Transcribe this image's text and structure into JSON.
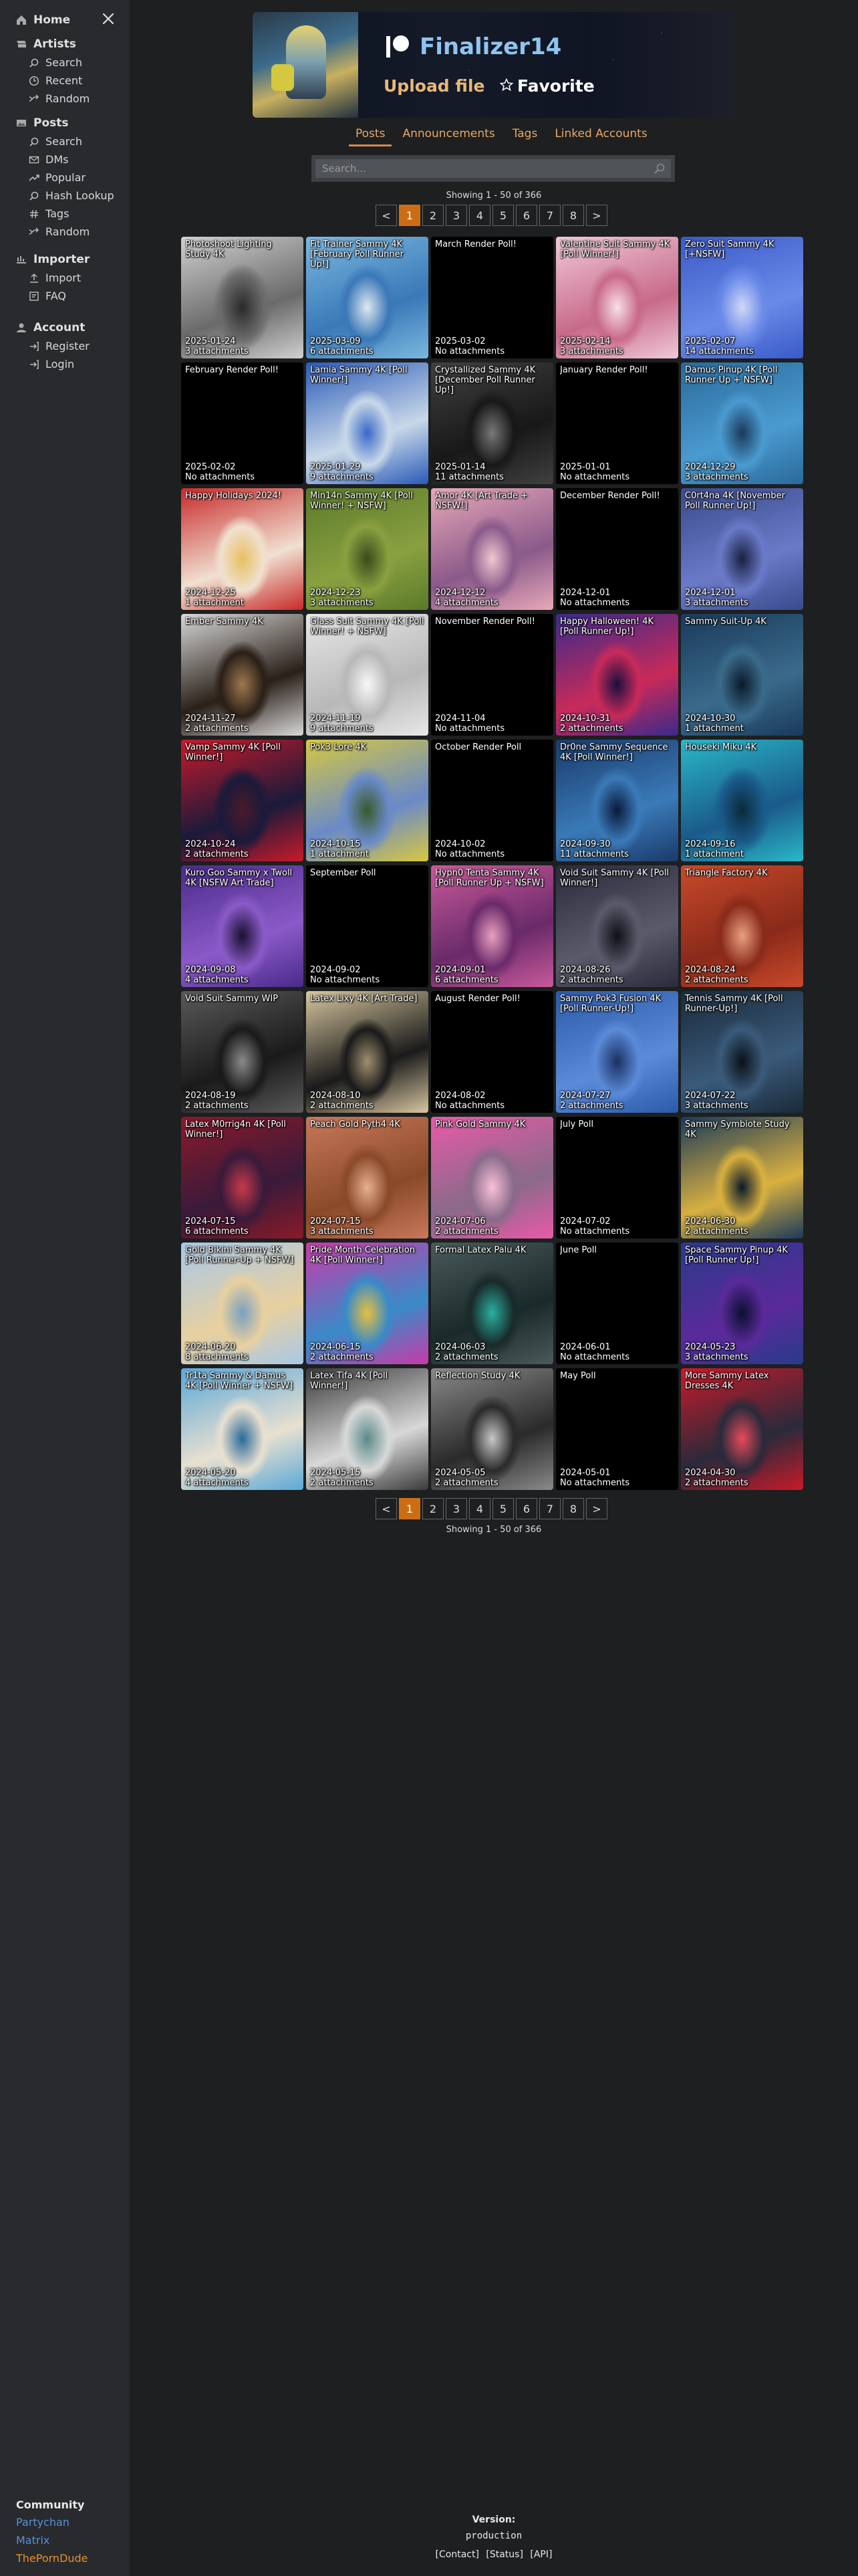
{
  "sidebar": {
    "home": "Home",
    "artists": {
      "title": "Artists",
      "items": [
        "Search",
        "Recent",
        "Random"
      ]
    },
    "posts": {
      "title": "Posts",
      "items": [
        "Search",
        "DMs",
        "Popular",
        "Hash Lookup",
        "Tags",
        "Random"
      ]
    },
    "importer": {
      "title": "Importer",
      "items": [
        "Import",
        "FAQ"
      ]
    },
    "account": {
      "title": "Account",
      "items": [
        "Register",
        "Login"
      ]
    },
    "community": {
      "title": "Community",
      "links": [
        "Partychan",
        "Matrix",
        "ThePornDude"
      ]
    }
  },
  "artist": {
    "name": "Finalizer14",
    "upload_label": "Upload file",
    "favorite_label": "Favorite"
  },
  "tabs": [
    "Posts",
    "Announcements",
    "Tags",
    "Linked Accounts"
  ],
  "search": {
    "placeholder": "Search..."
  },
  "showing": "Showing 1 - 50 of 366",
  "pagination": {
    "prev": "<",
    "pages": [
      "1",
      "2",
      "3",
      "4",
      "5",
      "6",
      "7",
      "8"
    ],
    "next": ">",
    "current": "1"
  },
  "posts": [
    {
      "title": "Photoshoot Lighting Study 4K",
      "date": "2025-01-24",
      "attachments": "3 attachments",
      "thumb": [
        "#d0d0d0",
        "#6a6a6a",
        "#2a2a2a"
      ]
    },
    {
      "title": "Fit Trainer Sammy 4K [February Poll Runner Up!]",
      "date": "2025-03-09",
      "attachments": "6 attachments",
      "thumb": [
        "#7ab8e0",
        "#3a78b8",
        "#e0e8f0"
      ]
    },
    {
      "title": "March Render Poll!",
      "date": "2025-03-02",
      "attachments": "No attachments",
      "thumb": null
    },
    {
      "title": "Valentine Suit Sammy 4K [Poll Winner!]",
      "date": "2025-02-14",
      "attachments": "3 attachments",
      "thumb": [
        "#f0c8d8",
        "#c86a8a",
        "#f8e0e8"
      ]
    },
    {
      "title": "Zero Suit Sammy 4K [+NSFW]",
      "date": "2025-02-07",
      "attachments": "14 attachments",
      "thumb": [
        "#3a5ac8",
        "#6a8ae8",
        "#d0d8f8"
      ]
    },
    {
      "title": "February Render Poll!",
      "date": "2025-02-02",
      "attachments": "No attachments",
      "thumb": null
    },
    {
      "title": "Lamia Sammy 4K [Poll Winner!]",
      "date": "2025-01-29",
      "attachments": "9 attachments",
      "thumb": [
        "#2a5ab8",
        "#c8d8e8",
        "#3868c8"
      ]
    },
    {
      "title": "Crystallized Sammy 4K [December Poll Runner Up!]",
      "date": "2025-01-14",
      "attachments": "11 attachments",
      "thumb": [
        "#404040",
        "#181818",
        "#787878"
      ]
    },
    {
      "title": "January Render Poll!",
      "date": "2025-01-01",
      "attachments": "No attachments",
      "thumb": null
    },
    {
      "title": "Damus Pinup 4K [Poll Runner Up + NSFW]",
      "date": "2024-12-29",
      "attachments": "3 attachments",
      "thumb": [
        "#2a6a9a",
        "#4a9ad0",
        "#1a3a5a"
      ]
    },
    {
      "title": "Happy Holidays 2024!",
      "date": "2024-12-25",
      "attachments": "1 attachment",
      "thumb": [
        "#c82a2a",
        "#f0e0d0",
        "#e8c060"
      ]
    },
    {
      "title": "Min14n Sammy 4K [Poll Winner! + NSFW]",
      "date": "2024-12-23",
      "attachments": "3 attachments",
      "thumb": [
        "#5a7a2a",
        "#8aa040",
        "#3a4a1a"
      ]
    },
    {
      "title": "Amor 4K [Art Trade + NSFW!]",
      "date": "2024-12-12",
      "attachments": "4 attachments",
      "thumb": [
        "#e8a8b8",
        "#8a5a8a",
        "#f0c8d0"
      ]
    },
    {
      "title": "December Render Poll!",
      "date": "2024-12-01",
      "attachments": "No attachments",
      "thumb": null
    },
    {
      "title": "C0rt4na 4K [November Poll Runner Up!]",
      "date": "2024-12-01",
      "attachments": "3 attachments",
      "thumb": [
        "#3a4a8a",
        "#6a7ac8",
        "#1a2040"
      ]
    },
    {
      "title": "Ember Sammy 4K",
      "date": "2024-11-27",
      "attachments": "2 attachments",
      "thumb": [
        "#d8d8d8",
        "#2a2018",
        "#a07850"
      ]
    },
    {
      "title": "Glass Suit Sammy 4K [Poll Winner! + NSFW]",
      "date": "2024-11-19",
      "attachments": "9 attachments",
      "thumb": [
        "#e8e8e8",
        "#b8b8b8",
        "#f8f8f8"
      ]
    },
    {
      "title": "November Render Poll!",
      "date": "2024-11-04",
      "attachments": "No attachments",
      "thumb": null
    },
    {
      "title": "Happy Halloween! 4K [Poll Runner Up!]",
      "date": "2024-10-31",
      "attachments": "2 attachments",
      "thumb": [
        "#3a2a8a",
        "#c82a5a",
        "#1a1040"
      ]
    },
    {
      "title": "Sammy Suit-Up 4K",
      "date": "2024-10-30",
      "attachments": "1 attachment",
      "thumb": [
        "#1a3a5a",
        "#3a6a8a",
        "#0a1a2a"
      ]
    },
    {
      "title": "Vamp Sammy 4K [Poll Winner!]",
      "date": "2024-10-24",
      "attachments": "2 attachments",
      "thumb": [
        "#c81a2a",
        "#1a1a3a",
        "#4a1a2a"
      ]
    },
    {
      "title": "Pok3 Lore 4K",
      "date": "2024-10-15",
      "attachments": "1 attachment",
      "thumb": [
        "#d8c840",
        "#6a8ac8",
        "#3a5a2a"
      ]
    },
    {
      "title": "October Render Poll",
      "date": "2024-10-02",
      "attachments": "No attachments",
      "thumb": null
    },
    {
      "title": "Dr0ne Sammy Sequence 4K [Poll Winner!]",
      "date": "2024-09-30",
      "attachments": "11 attachments",
      "thumb": [
        "#1a3a6a",
        "#3a7ab8",
        "#0a1a3a"
      ]
    },
    {
      "title": "Houseki Miku 4K",
      "date": "2024-09-16",
      "attachments": "1 attachment",
      "thumb": [
        "#2ab8c8",
        "#1a5a8a",
        "#0a2a3a"
      ]
    },
    {
      "title": "Kuro Goo Sammy x Twoll 4K [NSFW Art Trade]",
      "date": "2024-09-08",
      "attachments": "4 attachments",
      "thumb": [
        "#4a2a8a",
        "#8a5ac8",
        "#1a1030"
      ]
    },
    {
      "title": "September Poll",
      "date": "2024-09-02",
      "attachments": "No attachments",
      "thumb": null
    },
    {
      "title": "Hypn0 Tenta Sammy 4K [Poll Runner Up + NSFW]",
      "date": "2024-09-01",
      "attachments": "6 attachments",
      "thumb": [
        "#c85a9a",
        "#6a2a6a",
        "#e8a0c0"
      ]
    },
    {
      "title": "Void Suit Sammy 4K [Poll Winner!]",
      "date": "2024-08-26",
      "attachments": "2 attachments",
      "thumb": [
        "#2a2a3a",
        "#5a5a6a",
        "#101018"
      ]
    },
    {
      "title": "Triangle Factory 4K",
      "date": "2024-08-24",
      "attachments": "2 attachments",
      "thumb": [
        "#c84a2a",
        "#8a2a1a",
        "#e8a080"
      ]
    },
    {
      "title": "Void Suit Sammy WIP",
      "date": "2024-08-19",
      "attachments": "2 attachments",
      "thumb": [
        "#5a5a5a",
        "#1a1a1a",
        "#8a8a8a"
      ]
    },
    {
      "title": "Latex Lixy 4K [Art Trade]",
      "date": "2024-08-10",
      "attachments": "2 attachments",
      "thumb": [
        "#d8c8a0",
        "#1a1a1a",
        "#a09070"
      ]
    },
    {
      "title": "August Render Poll!",
      "date": "2024-08-02",
      "attachments": "No attachments",
      "thumb": null
    },
    {
      "title": "Sammy Pok3 Fusion 4K [Poll Runner-Up!]",
      "date": "2024-07-27",
      "attachments": "2 attachments",
      "thumb": [
        "#2a5aa8",
        "#5a8ad8",
        "#1a3060"
      ]
    },
    {
      "title": "Tennis Sammy 4K [Poll Runner-Up!]",
      "date": "2024-07-22",
      "attachments": "3 attachments",
      "thumb": [
        "#1a2a3a",
        "#3a5a7a",
        "#0a1018"
      ]
    },
    {
      "title": "Latex M0rrig4n 4K [Poll Winner!]",
      "date": "2024-07-15",
      "attachments": "6 attachments",
      "thumb": [
        "#8a1a2a",
        "#3a1a3a",
        "#c83a4a"
      ]
    },
    {
      "title": "Peach Gold Pyth4 4K",
      "date": "2024-07-15",
      "attachments": "3 attachments",
      "thumb": [
        "#c8785a",
        "#8a4a2a",
        "#e8b090"
      ]
    },
    {
      "title": "Pink Gold Sammy 4K",
      "date": "2024-07-06",
      "attachments": "2 attachments",
      "thumb": [
        "#e85aa8",
        "#8a6a8a",
        "#f8c0d8"
      ]
    },
    {
      "title": "July Poll",
      "date": "2024-07-02",
      "attachments": "No attachments",
      "thumb": null
    },
    {
      "title": "Sammy Symbiote Study 4K",
      "date": "2024-06-30",
      "attachments": "2 attachments",
      "thumb": [
        "#1a3a5a",
        "#d8b040",
        "#0a1a2a"
      ]
    },
    {
      "title": "Gold Bikini Sammy 4K [Poll Runner-Up + NSFW]",
      "date": "2024-06-20",
      "attachments": "8 attachments",
      "thumb": [
        "#a8c8e8",
        "#e8d0a0",
        "#7aa0c0"
      ]
    },
    {
      "title": "Pride Month Celebration 4K [Poll Winner!]",
      "date": "2024-06-15",
      "attachments": "2 attachments",
      "thumb": [
        "#c83aa8",
        "#3a8ac8",
        "#e8c040"
      ]
    },
    {
      "title": "Formal Latex Palu 4K",
      "date": "2024-06-03",
      "attachments": "2 attachments",
      "thumb": [
        "#4a5a5a",
        "#1a2a2a",
        "#2ab0a0"
      ]
    },
    {
      "title": "June Poll",
      "date": "2024-06-01",
      "attachments": "No attachments",
      "thumb": null
    },
    {
      "title": "Space Sammy Pinup 4K [Poll Runner Up!]",
      "date": "2024-05-23",
      "attachments": "3 attachments",
      "thumb": [
        "#2a3a8a",
        "#5a2a9a",
        "#0a1030"
      ]
    },
    {
      "title": "Tr1ta Sammy & Damus 4K [Poll Winner + NSFW]",
      "date": "2024-05-20",
      "attachments": "4 attachments",
      "thumb": [
        "#5aa8d8",
        "#e8e0d0",
        "#2a6a9a"
      ]
    },
    {
      "title": "Latex Tifa 4K [Poll Winner!]",
      "date": "2024-05-15",
      "attachments": "2 attachments",
      "thumb": [
        "#3a3a3a",
        "#d8d8d8",
        "#5a8a8a"
      ]
    },
    {
      "title": "Reflection Study 4K",
      "date": "2024-05-05",
      "attachments": "2 attachments",
      "thumb": [
        "#8a8a8a",
        "#2a2a2a",
        "#c8c8c8"
      ]
    },
    {
      "title": "May Poll",
      "date": "2024-05-01",
      "attachments": "No attachments",
      "thumb": null
    },
    {
      "title": "More Sammy Latex Dresses 4K",
      "date": "2024-04-30",
      "attachments": "2 attachments",
      "thumb": [
        "#c81a2a",
        "#2a2a3a",
        "#e84a5a"
      ]
    }
  ],
  "footer": {
    "version_label": "Version:",
    "version_value": "production",
    "links": [
      "[Contact]",
      "[Status]",
      "[API]"
    ]
  },
  "colors": {
    "accent": "#cc6d14",
    "tab_text": "#e8a868",
    "link_blue": "#5b8fd8",
    "link_orange": "#e8902c"
  }
}
